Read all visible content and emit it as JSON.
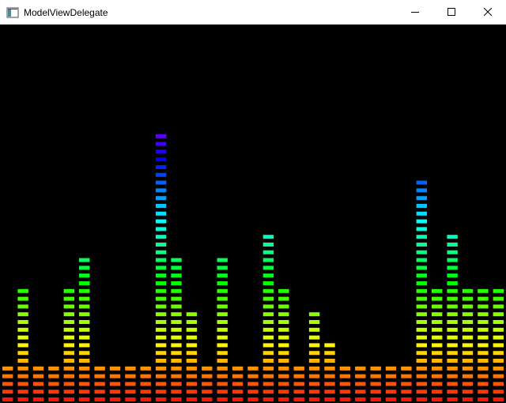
{
  "window": {
    "title": "ModelViewDelegate",
    "controls": [
      "minimize-icon",
      "maximize-icon",
      "close-icon"
    ]
  },
  "equalizer": {
    "background": "#000000",
    "segments_max": 36,
    "bars": [
      {
        "level": 5
      },
      {
        "level": 15
      },
      {
        "level": 5
      },
      {
        "level": 5
      },
      {
        "level": 15
      },
      {
        "level": 19
      },
      {
        "level": 5
      },
      {
        "level": 5
      },
      {
        "level": 5
      },
      {
        "level": 5
      },
      {
        "level": 35
      },
      {
        "level": 19
      },
      {
        "level": 12
      },
      {
        "level": 5
      },
      {
        "level": 19
      },
      {
        "level": 5
      },
      {
        "level": 5
      },
      {
        "level": 22
      },
      {
        "level": 15
      },
      {
        "level": 5
      },
      {
        "level": 12
      },
      {
        "level": 8
      },
      {
        "level": 5
      },
      {
        "level": 5
      },
      {
        "level": 5
      },
      {
        "level": 5
      },
      {
        "level": 5
      },
      {
        "level": 29
      },
      {
        "level": 15
      },
      {
        "level": 22
      },
      {
        "level": 15
      },
      {
        "level": 15
      },
      {
        "level": 15
      }
    ]
  }
}
